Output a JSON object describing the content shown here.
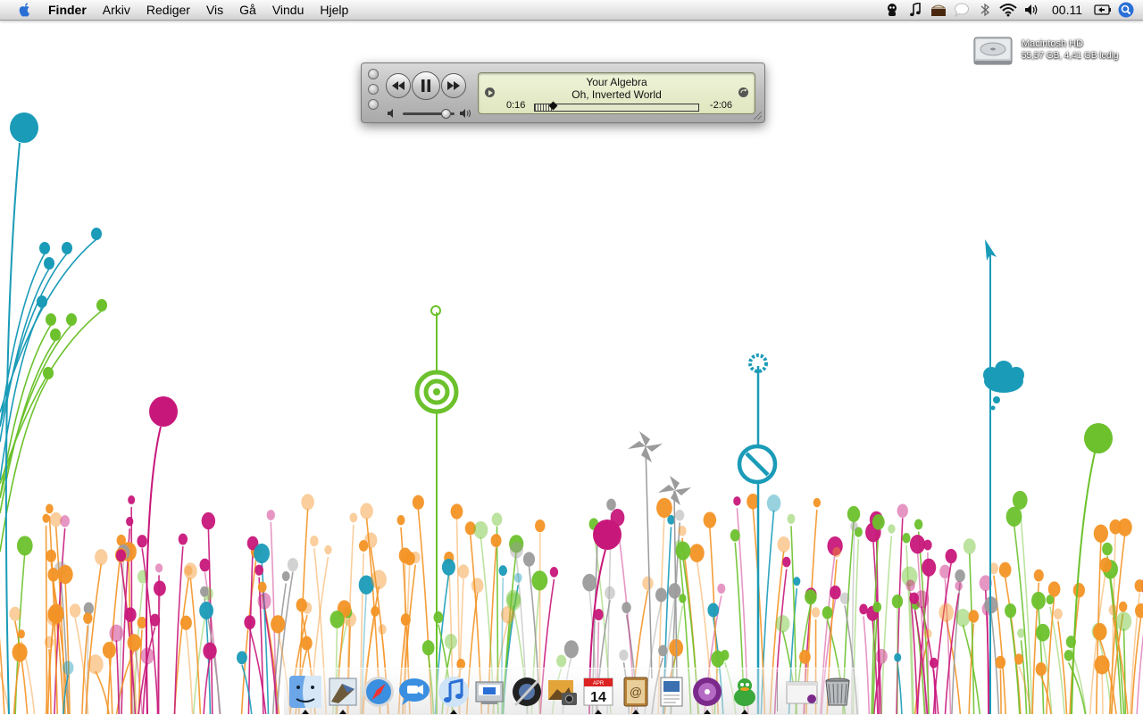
{
  "menubar": {
    "app_name": "Finder",
    "items": [
      "Arkiv",
      "Rediger",
      "Vis",
      "Gå",
      "Vindu",
      "Hjelp"
    ],
    "tray_icons": [
      "adium-icon",
      "itunes-note-icon",
      "battery-menu-icon",
      "speech-bubble-icon",
      "bluetooth-icon",
      "wifi-icon",
      "volume-icon"
    ],
    "clock": "00.11"
  },
  "desktop": {
    "hd_name": "Macintosh HD",
    "hd_info": "55,57 GB, 4,41 GB ledig"
  },
  "player": {
    "title": "Your Algebra",
    "artist": "Oh, Inverted World",
    "elapsed": "0:16",
    "remaining": "-2:06",
    "progress": 0.11,
    "volume": 0.82
  },
  "dock": {
    "icons": [
      "finder-icon",
      "mail-icon",
      "safari-icon",
      "ichat-icon",
      "itunes-icon",
      "system-preferences-icon",
      "aperture-icon",
      "iphoto-icon",
      "ical-icon",
      "address-book-icon",
      "preview-icon",
      "icon-disk-app",
      "adium-duck-icon",
      "minimized-window-icon",
      "trash-icon"
    ],
    "ical_day": "14",
    "ical_month": "APR"
  },
  "colors": {
    "teal": "#1a9bb8",
    "green": "#6cc12c",
    "magenta": "#c8177a",
    "orange": "#f39325",
    "gray": "#9b9b9b"
  }
}
